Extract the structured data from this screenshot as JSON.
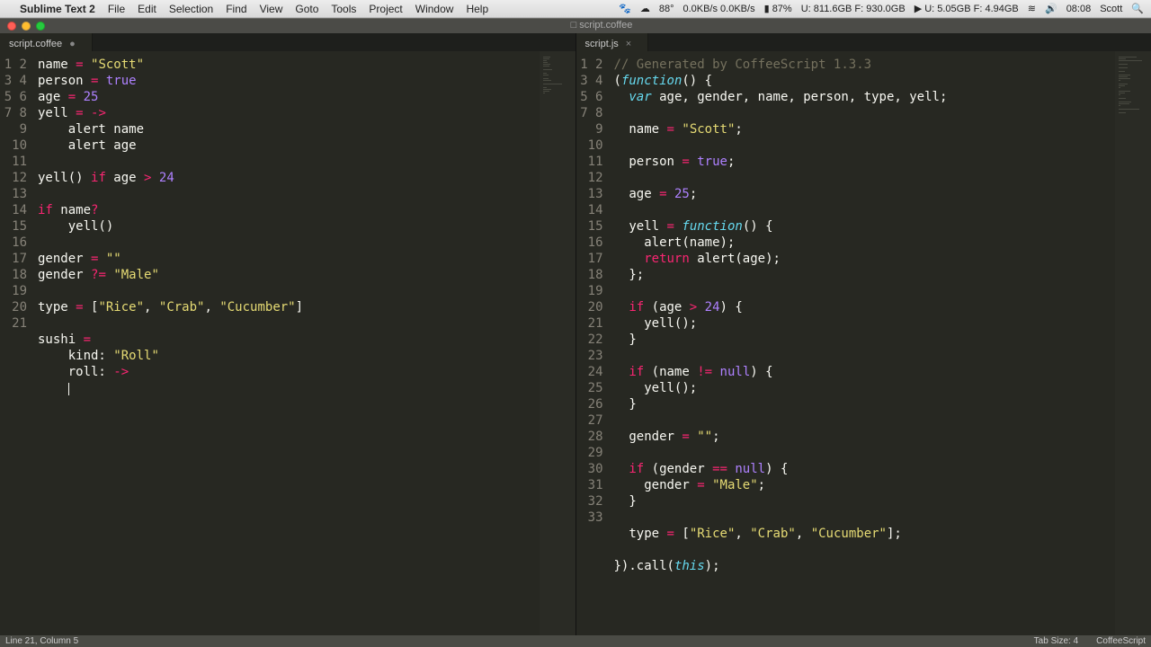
{
  "menubar": {
    "apple": "",
    "app": "Sublime Text 2",
    "items": [
      "File",
      "Edit",
      "Selection",
      "Find",
      "View",
      "Goto",
      "Tools",
      "Project",
      "Window",
      "Help"
    ],
    "right": {
      "temp": "88°",
      "net": "0.0KB/s 0.0KB/s",
      "batt": "87%",
      "disk1": "U: 811.6GB F: 930.0GB",
      "disk2": "U: 5.05GB F: 4.94GB",
      "vol_icon": "🔊",
      "wifi_icon": "≋",
      "time": "08:08",
      "user": "Scott",
      "spotlight": "🔍"
    }
  },
  "window_tab": "□ script.coffee",
  "panes": {
    "left": {
      "tab": "script.coffee",
      "dirty": "●"
    },
    "right": {
      "tab": "script.js",
      "close": "×"
    }
  },
  "status": {
    "left": "Line 21, Column 5",
    "tabsize": "Tab Size: 4",
    "lang": "CoffeeScript"
  },
  "left_lines": 21,
  "right_lines": 33,
  "left_code": [
    [
      [
        "id",
        "name "
      ],
      [
        "op",
        "= "
      ],
      [
        "str",
        "\"Scott\""
      ]
    ],
    [
      [
        "id",
        "person "
      ],
      [
        "op",
        "= "
      ],
      [
        "bool",
        "true"
      ]
    ],
    [
      [
        "id",
        "age "
      ],
      [
        "op",
        "= "
      ],
      [
        "num",
        "25"
      ]
    ],
    [
      [
        "id",
        "yell "
      ],
      [
        "op",
        "= "
      ],
      [
        "fn",
        "->"
      ]
    ],
    [
      [
        "id",
        "    alert name"
      ]
    ],
    [
      [
        "id",
        "    alert age"
      ]
    ],
    [
      [
        "id",
        ""
      ]
    ],
    [
      [
        "id",
        "yell() "
      ],
      [
        "kw2",
        "if"
      ],
      [
        "id",
        " age "
      ],
      [
        "op",
        "> "
      ],
      [
        "num",
        "24"
      ]
    ],
    [
      [
        "id",
        ""
      ]
    ],
    [
      [
        "kw2",
        "if"
      ],
      [
        "id",
        " name"
      ],
      [
        "op",
        "?"
      ]
    ],
    [
      [
        "id",
        "    yell()"
      ]
    ],
    [
      [
        "id",
        ""
      ]
    ],
    [
      [
        "id",
        "gender "
      ],
      [
        "op",
        "= "
      ],
      [
        "str",
        "\"\""
      ]
    ],
    [
      [
        "id",
        "gender "
      ],
      [
        "op",
        "?= "
      ],
      [
        "str",
        "\"Male\""
      ]
    ],
    [
      [
        "id",
        ""
      ]
    ],
    [
      [
        "id",
        "type "
      ],
      [
        "op",
        "= "
      ],
      [
        "id",
        "["
      ],
      [
        "str",
        "\"Rice\""
      ],
      [
        "id",
        ", "
      ],
      [
        "str",
        "\"Crab\""
      ],
      [
        "id",
        ", "
      ],
      [
        "str",
        "\"Cucumber\""
      ],
      [
        "id",
        "]"
      ]
    ],
    [
      [
        "id",
        ""
      ]
    ],
    [
      [
        "id",
        "sushi "
      ],
      [
        "op",
        "="
      ]
    ],
    [
      [
        "id",
        "    kind: "
      ],
      [
        "str",
        "\"Roll\""
      ]
    ],
    [
      [
        "id",
        "    roll: "
      ],
      [
        "fn",
        "->"
      ]
    ],
    [
      [
        "id",
        "    "
      ],
      [
        "cursor",
        ""
      ]
    ]
  ],
  "right_code": [
    [
      [
        "comment",
        "// Generated by CoffeeScript 1.3.3"
      ]
    ],
    [
      [
        "id",
        "("
      ],
      [
        "kw",
        "function"
      ],
      [
        "id",
        "() {"
      ]
    ],
    [
      [
        "id",
        "  "
      ],
      [
        "kw",
        "var"
      ],
      [
        "id",
        " age, gender, name, person, type, yell;"
      ]
    ],
    [
      [
        "id",
        ""
      ]
    ],
    [
      [
        "id",
        "  name "
      ],
      [
        "op",
        "="
      ],
      [
        "id",
        " "
      ],
      [
        "str",
        "\"Scott\""
      ],
      [
        "id",
        ";"
      ]
    ],
    [
      [
        "id",
        ""
      ]
    ],
    [
      [
        "id",
        "  person "
      ],
      [
        "op",
        "="
      ],
      [
        "id",
        " "
      ],
      [
        "bool",
        "true"
      ],
      [
        "id",
        ";"
      ]
    ],
    [
      [
        "id",
        ""
      ]
    ],
    [
      [
        "id",
        "  age "
      ],
      [
        "op",
        "="
      ],
      [
        "id",
        " "
      ],
      [
        "num",
        "25"
      ],
      [
        "id",
        ";"
      ]
    ],
    [
      [
        "id",
        ""
      ]
    ],
    [
      [
        "id",
        "  yell "
      ],
      [
        "op",
        "="
      ],
      [
        "id",
        " "
      ],
      [
        "kw",
        "function"
      ],
      [
        "id",
        "() {"
      ]
    ],
    [
      [
        "id",
        "    alert(name);"
      ]
    ],
    [
      [
        "id",
        "    "
      ],
      [
        "kw2",
        "return"
      ],
      [
        "id",
        " alert(age);"
      ]
    ],
    [
      [
        "id",
        "  };"
      ]
    ],
    [
      [
        "id",
        ""
      ]
    ],
    [
      [
        "id",
        "  "
      ],
      [
        "kw2",
        "if"
      ],
      [
        "id",
        " (age "
      ],
      [
        "op",
        ">"
      ],
      [
        "id",
        " "
      ],
      [
        "num",
        "24"
      ],
      [
        "id",
        ") {"
      ]
    ],
    [
      [
        "id",
        "    yell();"
      ]
    ],
    [
      [
        "id",
        "  }"
      ]
    ],
    [
      [
        "id",
        ""
      ]
    ],
    [
      [
        "id",
        "  "
      ],
      [
        "kw2",
        "if"
      ],
      [
        "id",
        " (name "
      ],
      [
        "op",
        "!="
      ],
      [
        "id",
        " "
      ],
      [
        "bool",
        "null"
      ],
      [
        "id",
        ") {"
      ]
    ],
    [
      [
        "id",
        "    yell();"
      ]
    ],
    [
      [
        "id",
        "  }"
      ]
    ],
    [
      [
        "id",
        ""
      ]
    ],
    [
      [
        "id",
        "  gender "
      ],
      [
        "op",
        "="
      ],
      [
        "id",
        " "
      ],
      [
        "str",
        "\"\""
      ],
      [
        "id",
        ";"
      ]
    ],
    [
      [
        "id",
        ""
      ]
    ],
    [
      [
        "id",
        "  "
      ],
      [
        "kw2",
        "if"
      ],
      [
        "id",
        " (gender "
      ],
      [
        "op",
        "=="
      ],
      [
        "id",
        " "
      ],
      [
        "bool",
        "null"
      ],
      [
        "id",
        ") {"
      ]
    ],
    [
      [
        "id",
        "    gender "
      ],
      [
        "op",
        "="
      ],
      [
        "id",
        " "
      ],
      [
        "str",
        "\"Male\""
      ],
      [
        "id",
        ";"
      ]
    ],
    [
      [
        "id",
        "  }"
      ]
    ],
    [
      [
        "id",
        ""
      ]
    ],
    [
      [
        "id",
        "  type "
      ],
      [
        "op",
        "="
      ],
      [
        "id",
        " ["
      ],
      [
        "str",
        "\"Rice\""
      ],
      [
        "id",
        ", "
      ],
      [
        "str",
        "\"Crab\""
      ],
      [
        "id",
        ", "
      ],
      [
        "str",
        "\"Cucumber\""
      ],
      [
        "id",
        "];"
      ]
    ],
    [
      [
        "id",
        ""
      ]
    ],
    [
      [
        "id",
        "}).call("
      ],
      [
        "kw",
        "this"
      ],
      [
        "id",
        ");"
      ]
    ],
    [
      [
        "id",
        ""
      ]
    ]
  ]
}
